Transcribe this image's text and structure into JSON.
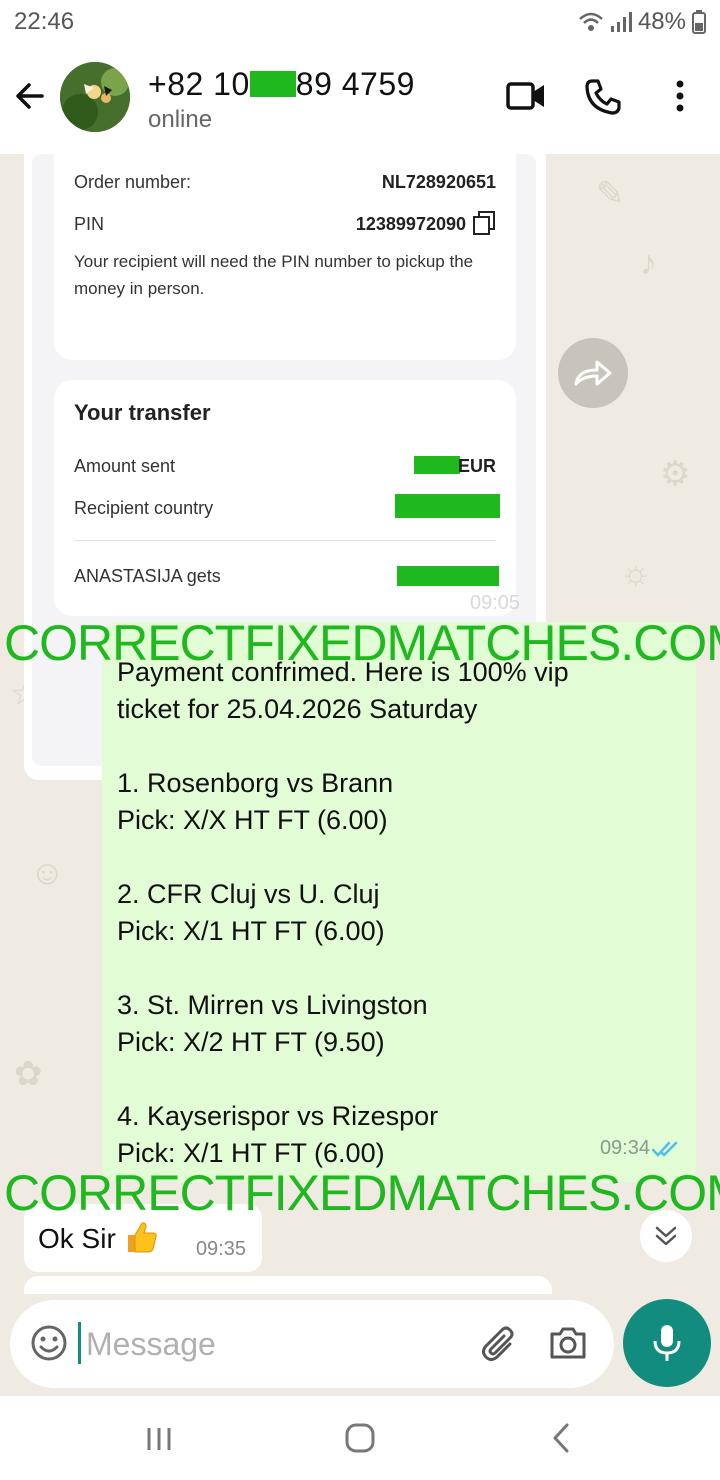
{
  "status_bar": {
    "time": "22:46",
    "battery": "48%"
  },
  "header": {
    "name_start": "+82 10",
    "name_end": "89 4759",
    "status": "online"
  },
  "transfer_screenshot": {
    "order_label": "Order number:",
    "order_value": "NL728920651",
    "pin_label": "PIN",
    "pin_value": "12389972090",
    "note": "Your recipient will need the PIN number to pickup the money in person.",
    "title": "Your transfer",
    "amount_label": "Amount sent",
    "amount_currency": "EUR",
    "country_label": "Recipient country",
    "gets_label": "ANASTASIJA gets",
    "image_time": "09:05"
  },
  "outgoing_message": {
    "text": "Payment confrimed. Here is 100% vip\nticket for 25.04.2026 Saturday\n\n1. Rosenborg vs Brann\nPick: X/X HT FT (6.00)\n\n2. CFR Cluj vs U. Cluj\nPick: X/1 HT FT (6.00)\n\n3. St. Mirren vs Livingston\nPick: X/2 HT FT (9.50)\n\n4. Kayserispor vs Rizespor\nPick: X/1 HT FT (6.00)",
    "time": "09:34"
  },
  "incoming_message": {
    "text": "Ok Sir",
    "time": "09:35"
  },
  "watermark": "CORRECTFIXEDMATCHES.COM",
  "input": {
    "placeholder": "Message"
  },
  "colors": {
    "accent": "#128c7e",
    "outgoing_bubble": "#e2fcd6",
    "watermark": "#1fb81f",
    "chat_bg": "#efeae2"
  },
  "icons": [
    "back-arrow-icon",
    "video-call-icon",
    "phone-icon",
    "more-options-icon",
    "forward-icon",
    "copy-icon",
    "double-check-icon",
    "thumbs-up-icon",
    "chevron-double-down-icon",
    "emoji-icon",
    "attach-icon",
    "camera-icon",
    "mic-icon",
    "recent-apps-icon",
    "home-icon",
    "nav-back-icon"
  ]
}
